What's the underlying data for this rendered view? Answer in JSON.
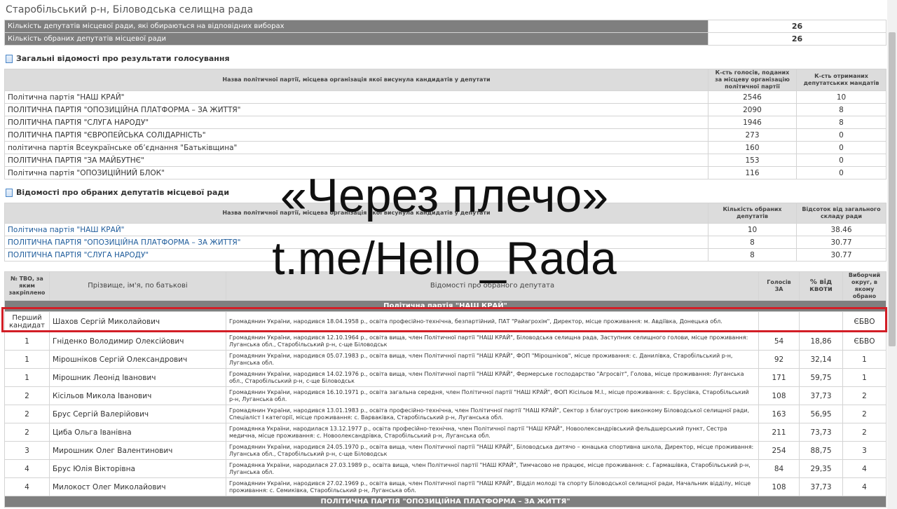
{
  "region": "Старобільський р-н, Біловодська селищна рада",
  "summary": [
    {
      "label": "Кількість депутатів місцевої ради, які обираються на відповідних виборах",
      "value": "26"
    },
    {
      "label": "Кількість обраних депутатів місцевої ради",
      "value": "26"
    }
  ],
  "voting": {
    "title": "Загальні відомості про результати голосування",
    "headers": [
      "Назва політичної партії, місцева організація якої висунула кандидатів у депутати",
      "К-сть голосів, поданих за місцеву організацію політичної партії",
      "К-сть отриманих депутатських мандатів"
    ],
    "rows": [
      {
        "party": "Політична партія \"НАШ КРАЙ\"",
        "votes": "2546",
        "mandates": "10"
      },
      {
        "party": "ПОЛІТИЧНА ПАРТІЯ \"ОПОЗИЦІЙНА ПЛАТФОРМА – ЗА ЖИТТЯ\"",
        "votes": "2090",
        "mandates": "8"
      },
      {
        "party": "ПОЛІТИЧНА ПАРТІЯ \"СЛУГА НАРОДУ\"",
        "votes": "1946",
        "mandates": "8"
      },
      {
        "party": "ПОЛІТИЧНА ПАРТІЯ \"ЄВРОПЕЙСЬКА СОЛІДАРНІСТЬ\"",
        "votes": "273",
        "mandates": "0"
      },
      {
        "party": "політична партія Всеукраїнське об’єднання \"Батьківщина\"",
        "votes": "160",
        "mandates": "0"
      },
      {
        "party": "ПОЛІТИЧНА ПАРТІЯ \"ЗА МАЙБУТНЄ\"",
        "votes": "153",
        "mandates": "0"
      },
      {
        "party": "Політична партія \"ОПОЗИЦІЙНИЙ БЛОК\"",
        "votes": "116",
        "mandates": "0"
      }
    ]
  },
  "elected": {
    "title": "Відомості про обраних депутатів місцевої ради",
    "headers": [
      "Назва політичної партії, місцева організація якої висунула кандидатів у депутати",
      "Кількість обраних депутатів",
      "Відсоток від загального складу ради"
    ],
    "rows": [
      {
        "party": "Політична партія \"НАШ КРАЙ\"",
        "count": "10",
        "percent": "38.46"
      },
      {
        "party": "ПОЛІТИЧНА ПАРТІЯ \"ОПОЗИЦІЙНА ПЛАТФОРМА – ЗА ЖИТТЯ\"",
        "count": "8",
        "percent": "30.77"
      },
      {
        "party": "ПОЛІТИЧНА ПАРТІЯ \"СЛУГА НАРОДУ\"",
        "count": "8",
        "percent": "30.77"
      }
    ]
  },
  "deputies": {
    "headers": [
      "№ ТВО, за яким закріплено",
      "Прізвище, ім'я, по батькові",
      "Відомості про обраного депутата",
      "Голосів ЗА",
      "% від квоти",
      "Виборчий округ, в якому обрано"
    ],
    "party1": "Політична партія \"НАШ КРАЙ\"",
    "first": {
      "tvo": "Перший кандидат",
      "name": "Шахов Сергій Миколайович",
      "info": "Громадянин України, народився 18.04.1958 р., освіта професійно-технічна, безпартійний, ПАТ \"Райагрохім\", Директор, місце проживання: м. Авдіївка, Донецька обл.",
      "votes": "",
      "quota": "",
      "district": "ЄБВО"
    },
    "rows": [
      {
        "tvo": "1",
        "name": "Гніденко Володимир Олексійович",
        "info": "Громадянин України, народився 12.10.1964 р., освіта вища, член Політичної партії \"НАШ КРАЙ\", Біловодська селищна рада, Заступник селищного голови, місце проживання: Луганська обл., Старобільський р-н, с-ще Біловодськ",
        "votes": "54",
        "quota": "18,86",
        "district": "ЄБВО"
      },
      {
        "tvo": "1",
        "name": "Мірошніков Сергій Олександрович",
        "info": "Громадянин України, народився 05.07.1983 р., освіта вища, член Політичної партії \"НАШ КРАЙ\", ФОП \"Мірошніков\", місце проживання: с. Данилівка, Старобільський р-н, Луганська обл.",
        "votes": "92",
        "quota": "32,14",
        "district": "1"
      },
      {
        "tvo": "1",
        "name": "Мірошник Леонід Іванович",
        "info": "Громадянин України, народився 14.02.1976 р., освіта вища, член Політичної партії \"НАШ КРАЙ\", Фермерське господарство \"Агросвіт\", Голова, місце проживання: Луганська обл., Старобільський р-н, с-ще Біловодськ",
        "votes": "171",
        "quota": "59,75",
        "district": "1"
      },
      {
        "tvo": "2",
        "name": "Кісільов Микола Іванович",
        "info": "Громадянин України, народився 16.10.1971 р., освіта загальна середня, член Політичної партії \"НАШ КРАЙ\", ФОП Кісільов М.І., місце проживання: с. Брусівка, Старобільський р-н, Луганська обл.",
        "votes": "108",
        "quota": "37,73",
        "district": "2"
      },
      {
        "tvo": "2",
        "name": "Брус Сергій Валерійович",
        "info": "Громадянин України, народився 13.01.1983 р., освіта професійно-технічна, член Політичної партії \"НАШ КРАЙ\", Сектор з благоустрою виконкому Біловодської селищної ради, Спеціаліст I категорії, місце проживання: с. Варваківка, Старобільський р-н, Луганська обл.",
        "votes": "163",
        "quota": "56,95",
        "district": "2"
      },
      {
        "tvo": "2",
        "name": "Циба Ольга Іванівна",
        "info": "Громадянка України, народилася 13.12.1977 р., освіта професійно-технічна, член Політичної партії \"НАШ КРАЙ\", Новоолександрівський фельдшерський пункт, Сестра медична, місце проживання: с. Новоолександрівка, Старобільський р-н, Луганська обл.",
        "votes": "211",
        "quota": "73,73",
        "district": "2"
      },
      {
        "tvo": "3",
        "name": "Мирошник Олег Валентинович",
        "info": "Громадянин України, народився 24.05.1970 р., освіта вища, член Політичної партії \"НАШ КРАЙ\", Біловодська дитячо – юнацька спортивна школа, Директор, місце проживання: Луганська обл., Старобільський р-н, с-ще Біловодськ",
        "votes": "254",
        "quota": "88,75",
        "district": "3"
      },
      {
        "tvo": "4",
        "name": "Брус Юлія Вікторівна",
        "info": "Громадянка України, народилася 27.03.1989 р., освіта вища, член Політичної партії \"НАШ КРАЙ\", Тимчасово не працює, місце проживання: с. Гармашівка, Старобільський р-н, Луганська обл.",
        "votes": "84",
        "quota": "29,35",
        "district": "4"
      },
      {
        "tvo": "4",
        "name": "Милокост Олег Миколайович",
        "info": "Громадянин України, народився 27.02.1969 р., освіта вища, член Політичної партії \"НАШ КРАЙ\", Відділ молоді та спорту Біловодської селищної ради, Начальник відділу, місце проживання: с. Семиківка, Старобільський р-н, Луганська обл.",
        "votes": "108",
        "quota": "37,73",
        "district": "4"
      }
    ],
    "party2": "ПОЛІТИЧНА ПАРТІЯ \"ОПОЗИЦІЙНА ПЛАТФОРМА – ЗА ЖИТТЯ\""
  },
  "overlay": {
    "line1": "«Через плечо»",
    "line2": "t.me/Hello_Rada"
  },
  "colors": {
    "header_bg": "#7f7f7f",
    "link": "#1c5a9a",
    "highlight": "#d21e26"
  }
}
